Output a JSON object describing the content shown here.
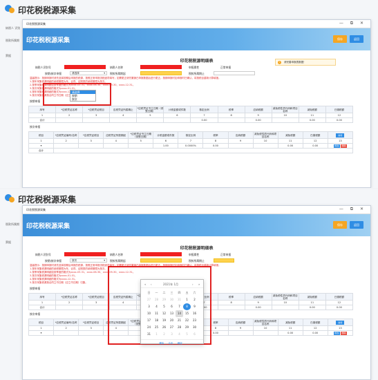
{
  "app": {
    "title": "印花税税源采集"
  },
  "bg": {
    "side1": "纳税人 识别",
    "side2": "税款所属期",
    "side3": "票据"
  },
  "window": {
    "bar_title": "印花税税源采集",
    "controls": "— ⧉ ✕",
    "banner_title": "印花税税源采集",
    "save_label": "保存",
    "back_label": "返回"
  },
  "notice": {
    "icon": "!",
    "text": "请完善申报表数据！"
  },
  "form": {
    "title": "印花税税源明细表",
    "taxpayer_id_label": "纳税人识别号",
    "taxpayer_name_label": "纳税人名称",
    "tax_authority_label": "申报属性",
    "tax_authority_value": "正常申报",
    "period_type_label": "按期/按次申报",
    "period_type_value": "请选择",
    "period_start_label": "税款所属期起",
    "period_end_label": "税款所属期止"
  },
  "dropdown": {
    "options": [
      "请选择",
      "按期",
      "按次"
    ],
    "selected": "请选择"
  },
  "notes": [
    "温馨提示：按期申报时请先选择按期后申报的税源，按照正常申报流程逐项填写；如需更正请先撤销已申报数据后进行更正。按期申报时如申报时已确认，将按税目重新计算填报。",
    "1.按年采集税源明细的纳税期限为年，合同、证照类的纳税期限为按次。",
    "2.按季采集税源明细如按季度的格式为xxxx-03-31、xxxx-06-30、xxxx-09-30、xxxx-12-31。",
    "3.按次采集税源明细的格式为xxxx-01-01。",
    "4.按年采集税源明细的格式为xxxx-12-31。",
    "5.按次采集税源按合同立书日期（应立书日期）归集。"
  ],
  "section1": {
    "title": "按期申报",
    "headers": [
      "序号",
      "*应税凭证名称",
      "*应税凭证税目",
      "应税凭证所属期止",
      "*应税凭证书立日期（领受日期）",
      "计税金额或件数",
      "核定比例",
      "税率",
      "应纳税额",
      "减免税性质代码和项目名称",
      "减免税额",
      "已缴税额"
    ],
    "nums": [
      "1",
      "2",
      "3",
      "4",
      "5",
      "6",
      "7",
      "8",
      "9",
      "10",
      "11",
      "12"
    ],
    "total_label": "合计",
    "total_values": [
      "0.00",
      "0.00",
      "0.00",
      "0.00"
    ]
  },
  "section2": {
    "title": "按次申报",
    "add_label": "新增",
    "headers": [
      "税目",
      "*应税凭证编号/名称",
      "*应税凭证税目",
      "应税凭证所属期起",
      "*应税凭证书立日期（领受日期）",
      "计税金额或件数",
      "核定比例",
      "税率",
      "应纳税额",
      "减免税性质代码和项目名称",
      "减免税额",
      "已缴税额",
      "操作"
    ],
    "nums": [
      "1",
      "2",
      "3",
      "4",
      "5",
      "6",
      "7",
      "8",
      "9",
      "10",
      "11",
      "12",
      "13"
    ],
    "row": {
      "rate": "0.0000%",
      "ratio": "1.00",
      "tax": "0.00",
      "relief": "0.00",
      "paid": "0.00"
    },
    "total_label": "合计",
    "row_btn_edit": "修改",
    "row_btn_del": "删除"
  },
  "form2": {
    "period_type_value": "按次"
  },
  "calendar": {
    "month_label": "2021年 1月",
    "prev_year": "«",
    "prev_month": "‹",
    "next_month": "›",
    "next_year": "»",
    "weekdays": [
      "日",
      "一",
      "二",
      "三",
      "四",
      "五",
      "六"
    ],
    "days": [
      "27",
      "28",
      "29",
      "30",
      "31",
      "1",
      "2",
      "3",
      "4",
      "5",
      "6",
      "7",
      "8",
      "9",
      "10",
      "11",
      "12",
      "13",
      "14",
      "15",
      "16",
      "17",
      "18",
      "19",
      "20",
      "21",
      "22",
      "23",
      "24",
      "25",
      "26",
      "27",
      "28",
      "29",
      "30",
      "31",
      "1",
      "2",
      "3",
      "4",
      "5",
      "6"
    ],
    "footer": [
      "清除",
      "今天",
      "确定"
    ]
  }
}
